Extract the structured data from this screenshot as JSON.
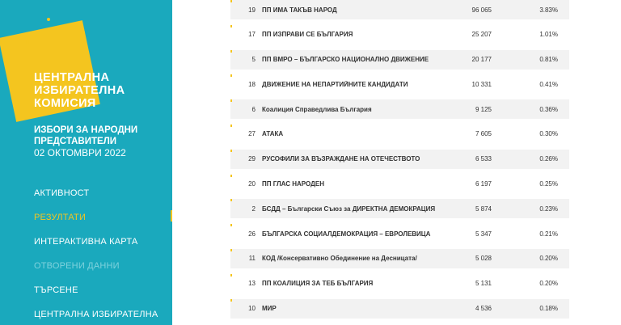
{
  "brand": {
    "line1": "ЦЕНТРАЛНА",
    "line2": "ИЗБИРАТЕЛНА",
    "line3": "КОМИСИЯ"
  },
  "election": {
    "line1": "ИЗБОРИ ЗА НАРОДНИ",
    "line2": "ПРЕДСТАВИТЕЛИ",
    "date": "02 ОКТОМВРИ 2022"
  },
  "nav": [
    {
      "label": "АКТИВНОСТ",
      "state": "normal"
    },
    {
      "label": "РЕЗУЛТАТИ",
      "state": "active"
    },
    {
      "label": "ИНТЕРАКТИВНА КАРТА",
      "state": "normal"
    },
    {
      "label": "ОТВОРЕНИ ДАННИ",
      "state": "disabled"
    },
    {
      "label": "ТЪРСЕНЕ",
      "state": "normal"
    },
    {
      "label": "ЦЕНТРАЛНА ИЗБИРАТЕЛНА",
      "state": "normal"
    }
  ],
  "rows": [
    {
      "num": "19",
      "name": "ПП ИМА ТАКЪВ НАРОД",
      "votes": "96 065",
      "pct": "3.83%",
      "bar": 0.038
    },
    {
      "num": "17",
      "name": "ПП ИЗПРАВИ СЕ БЪЛГАРИЯ",
      "votes": "25 207",
      "pct": "1.01%",
      "bar": 0.01
    },
    {
      "num": "5",
      "name": "ПП ВМРО – БЪЛГАРСКО НАЦИОНАЛНО ДВИЖЕНИЕ",
      "votes": "20 177",
      "pct": "0.81%",
      "bar": 0.008
    },
    {
      "num": "18",
      "name": "ДВИЖЕНИЕ НА НЕПАРТИЙНИТЕ КАНДИДАТИ",
      "votes": "10 331",
      "pct": "0.41%",
      "bar": 0.004
    },
    {
      "num": "6",
      "name": "Коалиция Справедлива България",
      "votes": "9 125",
      "pct": "0.36%",
      "bar": 0.004
    },
    {
      "num": "27",
      "name": "АТАКА",
      "votes": "7 605",
      "pct": "0.30%",
      "bar": 0.003
    },
    {
      "num": "29",
      "name": "РУСОФИЛИ ЗА ВЪЗРАЖДАНЕ НА ОТЕЧЕСТВОТО",
      "votes": "6 533",
      "pct": "0.26%",
      "bar": 0.003
    },
    {
      "num": "20",
      "name": "ПП ГЛАС НАРОДЕН",
      "votes": "6 197",
      "pct": "0.25%",
      "bar": 0.002
    },
    {
      "num": "2",
      "name": "БСДД – Български Съюз за ДИРЕКТНА ДЕМОКРАЦИЯ",
      "votes": "5 874",
      "pct": "0.23%",
      "bar": 0.002
    },
    {
      "num": "26",
      "name": "БЪЛГАРСКА СОЦИАЛДЕМОКРАЦИЯ – ЕВРОЛЕВИЦА",
      "votes": "5 347",
      "pct": "0.21%",
      "bar": 0.002
    },
    {
      "num": "11",
      "name": "КОД /Консервативно Обединение на Десницата/",
      "votes": "5 028",
      "pct": "0.20%",
      "bar": 0.002
    },
    {
      "num": "13",
      "name": "ПП КОАЛИЦИЯ ЗА ТЕБ БЪЛГАРИЯ",
      "votes": "5 131",
      "pct": "0.20%",
      "bar": 0.002
    },
    {
      "num": "10",
      "name": "МИР",
      "votes": "4 536",
      "pct": "0.18%",
      "bar": 0.002
    }
  ],
  "colors": {
    "sidebar": "#1aa9bd",
    "accent": "#f4c51f",
    "row_stripe": "#f2f2f2"
  }
}
